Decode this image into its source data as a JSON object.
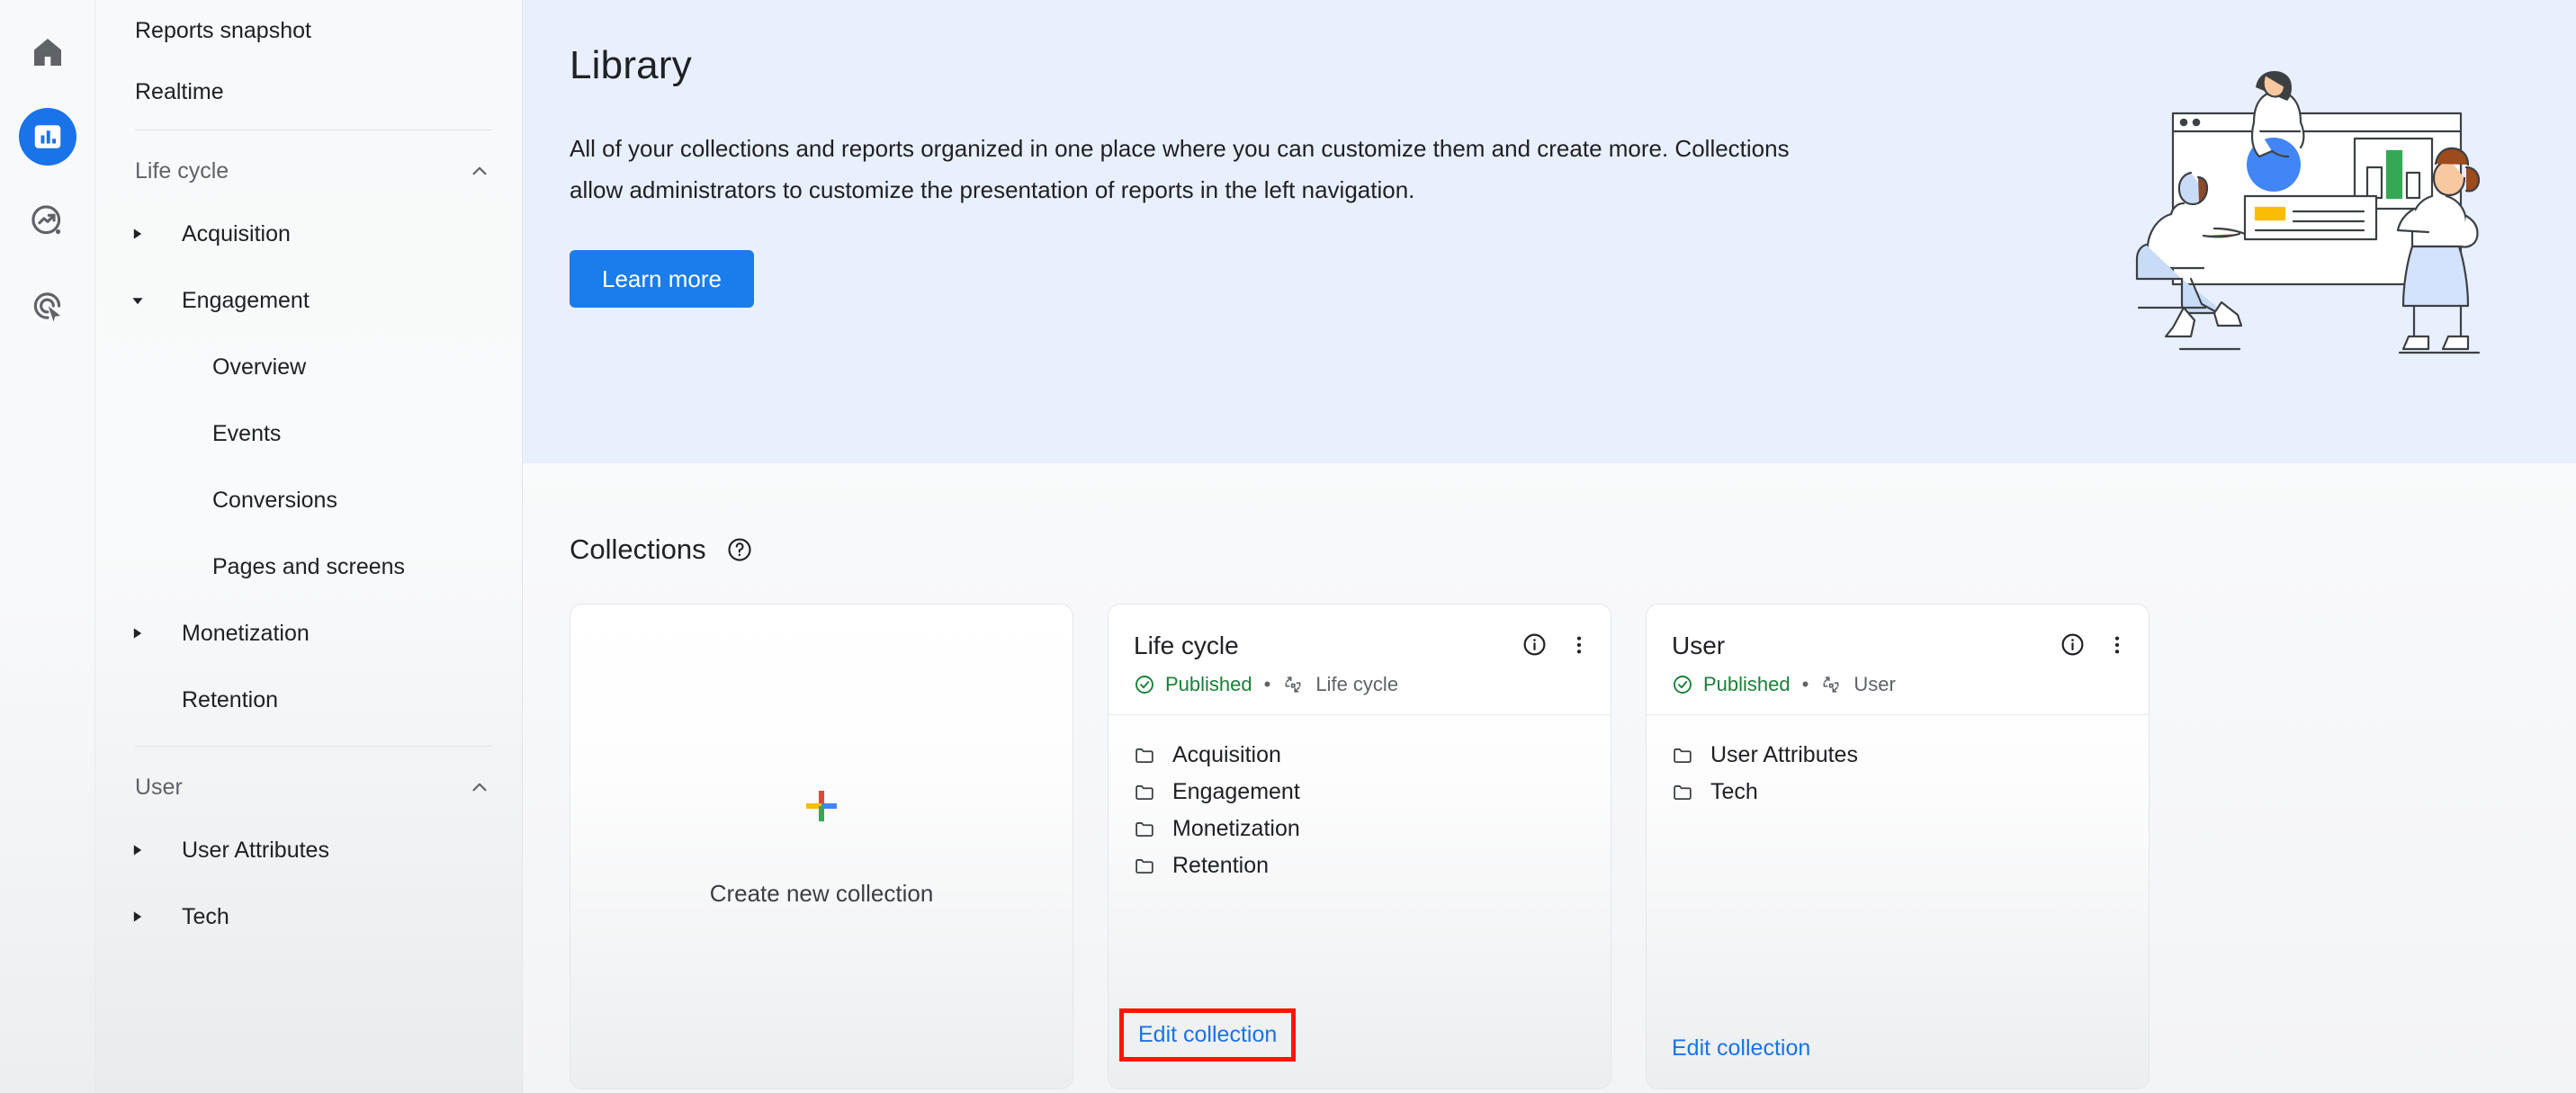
{
  "rail": {
    "items": [
      {
        "name": "home-icon",
        "label": "Home",
        "active": false
      },
      {
        "name": "reports-icon",
        "label": "Reports",
        "active": true
      },
      {
        "name": "explore-icon",
        "label": "Explore",
        "active": false
      },
      {
        "name": "advertising-icon",
        "label": "Advertising",
        "active": false
      }
    ]
  },
  "sidebar": {
    "top_items": [
      {
        "label": "Reports snapshot"
      },
      {
        "label": "Realtime"
      }
    ],
    "sections": [
      {
        "label": "Life cycle",
        "collapse_icon": "chevron-up-icon",
        "items": [
          {
            "label": "Acquisition",
            "arrow": "triangle-right-icon",
            "level": "group"
          },
          {
            "label": "Engagement",
            "arrow": "triangle-down-icon",
            "level": "group"
          },
          {
            "label": "Overview",
            "arrow": "",
            "level": "leaf"
          },
          {
            "label": "Events",
            "arrow": "",
            "level": "leaf"
          },
          {
            "label": "Conversions",
            "arrow": "",
            "level": "leaf"
          },
          {
            "label": "Pages and screens",
            "arrow": "",
            "level": "leaf"
          },
          {
            "label": "Monetization",
            "arrow": "triangle-right-icon",
            "level": "group"
          },
          {
            "label": "Retention",
            "arrow": "",
            "level": "group-noarrow"
          }
        ]
      },
      {
        "label": "User",
        "collapse_icon": "chevron-up-icon",
        "items": [
          {
            "label": "User Attributes",
            "arrow": "triangle-right-icon",
            "level": "group"
          },
          {
            "label": "Tech",
            "arrow": "triangle-right-icon",
            "level": "group"
          }
        ]
      }
    ]
  },
  "hero": {
    "title": "Library",
    "description": "All of your collections and reports organized in one place where you can customize them and create more. Collections allow administrators to customize the presentation of reports in the left navigation.",
    "learn_more_label": "Learn more",
    "background_color": "#e8f0fe",
    "button_color": "#1b7ceb",
    "illustration": "people-with-dashboard-illustration"
  },
  "collections": {
    "heading": "Collections",
    "help_icon": "help-circle-icon",
    "create_card": {
      "label": "Create new collection",
      "icon": "google-plus-icon",
      "icon_colors": {
        "top": "#ea4335",
        "left": "#fbbc04",
        "right": "#4285f4",
        "bottom": "#34a853"
      }
    },
    "cards": [
      {
        "title": "Life cycle",
        "status": "Published",
        "status_color": "#188038",
        "status_icon": "check-circle-icon",
        "separator": "•",
        "template_icon": "template-icon",
        "template_label": "Life cycle",
        "info_icon": "info-circle-icon",
        "menu_icon": "more-vert-icon",
        "folders": [
          "Acquisition",
          "Engagement",
          "Monetization",
          "Retention"
        ],
        "edit_label": "Edit collection",
        "edit_highlighted": true,
        "highlight_color": "#ff1500"
      },
      {
        "title": "User",
        "status": "Published",
        "status_color": "#188038",
        "status_icon": "check-circle-icon",
        "separator": "•",
        "template_icon": "template-icon",
        "template_label": "User",
        "info_icon": "info-circle-icon",
        "menu_icon": "more-vert-icon",
        "folders": [
          "User Attributes",
          "Tech"
        ],
        "edit_label": "Edit collection",
        "edit_highlighted": false,
        "highlight_color": "#ff1500"
      }
    ]
  }
}
